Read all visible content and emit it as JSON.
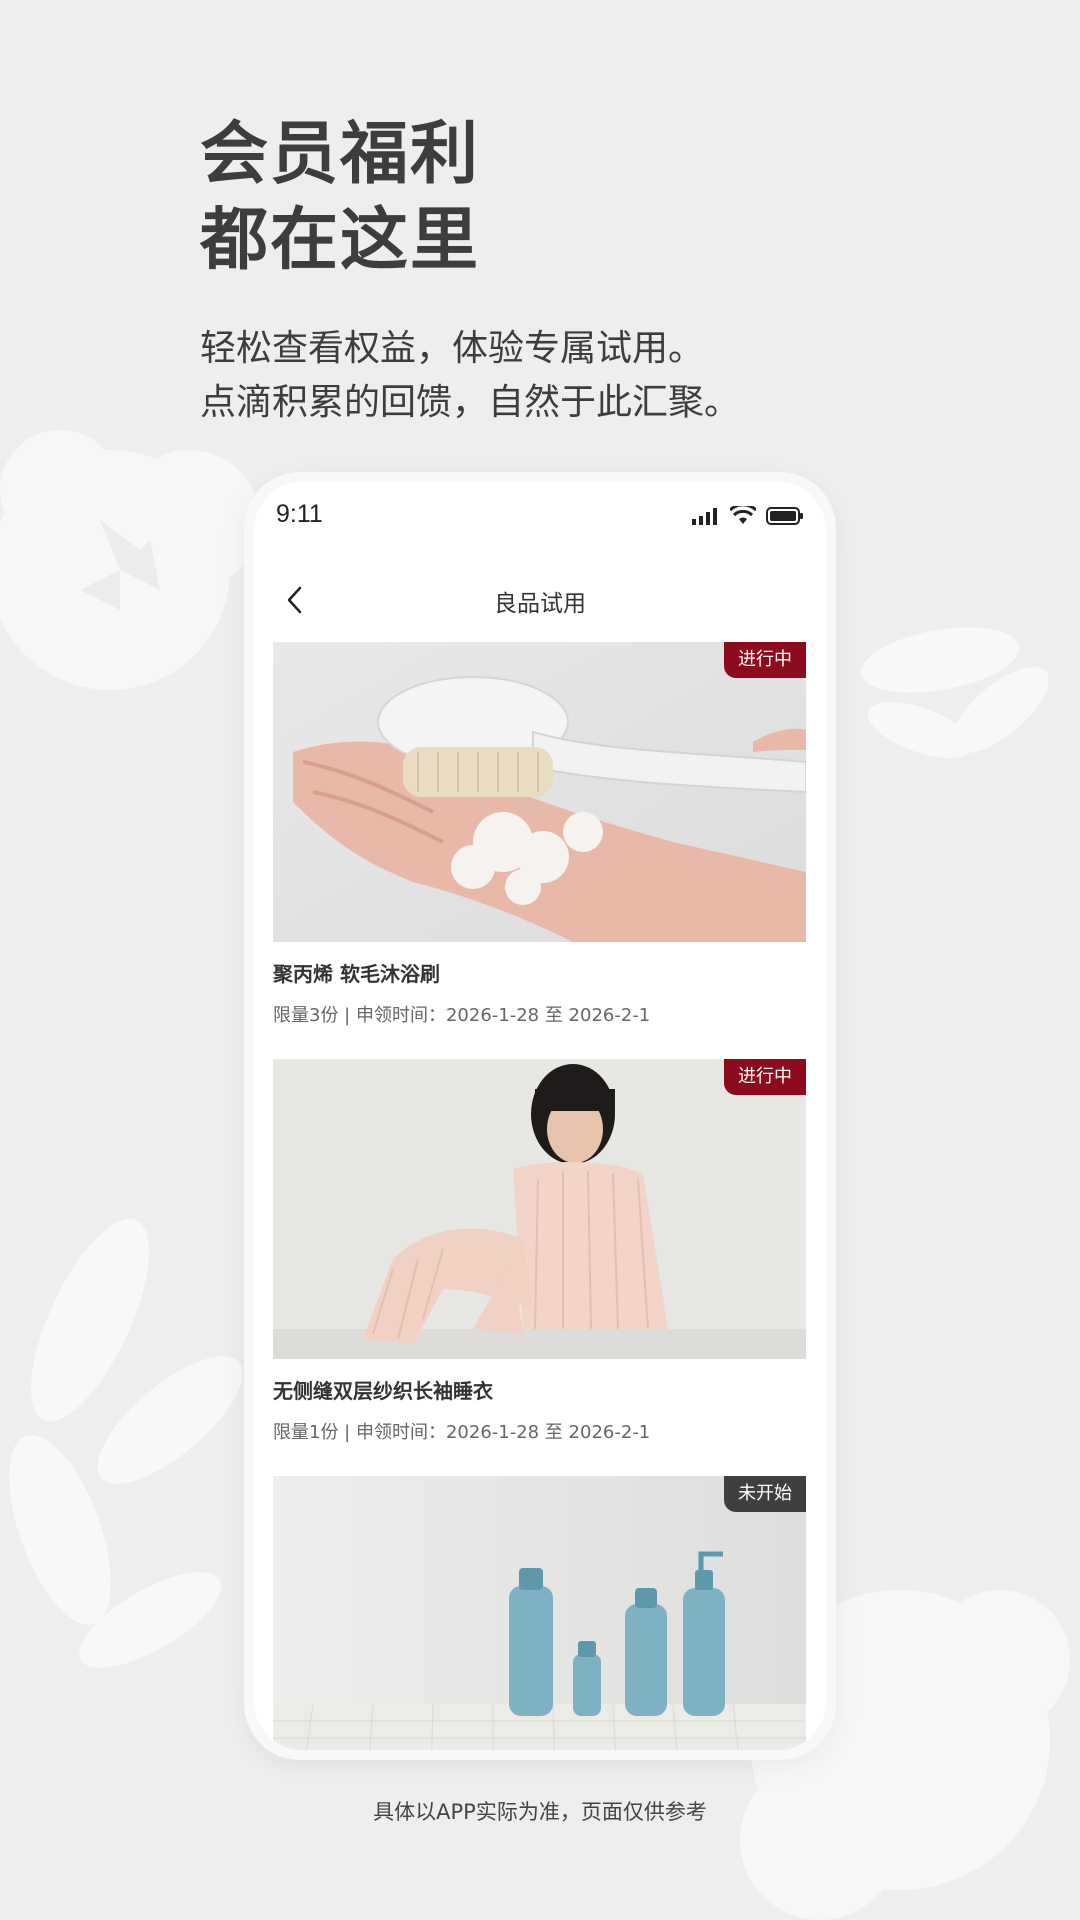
{
  "promo": {
    "headline_line1": "会员福利",
    "headline_line2": "都在这里",
    "subtitle_line1": "轻松查看权益，体验专属试用。",
    "subtitle_line2": "点滴积累的回馈，自然于此汇聚。",
    "footer_note": "具体以APP实际为准，页面仅供参考"
  },
  "status_bar": {
    "time": "9:11",
    "icons": [
      "signal-icon",
      "wifi-icon",
      "battery-icon"
    ]
  },
  "nav": {
    "title": "良品试用",
    "back_icon": "chevron-left-icon"
  },
  "trials": [
    {
      "badge": "进行中",
      "badge_state": "active",
      "title": "聚丙烯 软毛沐浴刷",
      "meta": "限量3份 | 申领时间：2026-1-28 至 2026-2-1",
      "image": "bath-brush-photo"
    },
    {
      "badge": "进行中",
      "badge_state": "active",
      "title": "无侧缝双层纱织长袖睡衣",
      "meta": "限量1份 | 申领时间：2026-1-28 至 2026-2-1",
      "image": "pajamas-photo"
    },
    {
      "badge": "未开始",
      "badge_state": "pending",
      "title": "",
      "meta": "",
      "image": "skincare-bottles-photo"
    }
  ],
  "colors": {
    "background": "#eeeeee",
    "badge_active": "#8c0b1c",
    "badge_pending": "#3f3f42",
    "headline": "#3d3d3f"
  }
}
